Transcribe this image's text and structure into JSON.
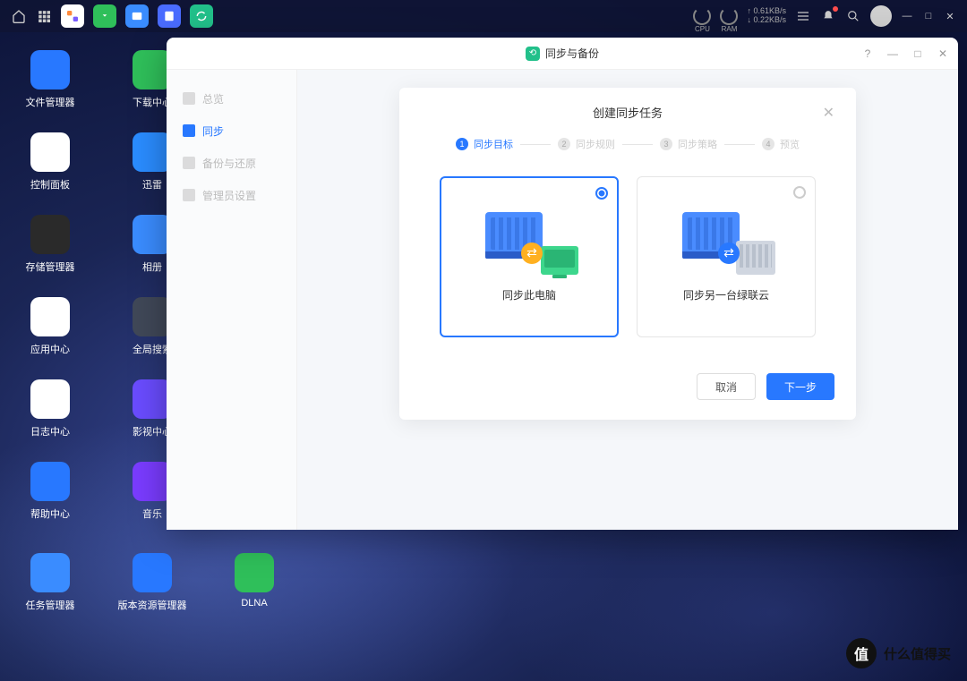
{
  "topbar": {
    "cpu_label": "CPU",
    "ram_label": "RAM",
    "net_up": "↑ 0.61KB/s",
    "net_down": "↓ 0.22KB/s"
  },
  "desktop_icons": {
    "col1": [
      {
        "label": "文件管理器",
        "bg": "#2878ff"
      },
      {
        "label": "控制面板",
        "bg": "#ffffff"
      },
      {
        "label": "存储管理器",
        "bg": "#2a2a2a"
      },
      {
        "label": "应用中心",
        "bg": "#ffffff"
      },
      {
        "label": "日志中心",
        "bg": "#ffffff"
      },
      {
        "label": "帮助中心",
        "bg": "#2878ff"
      },
      {
        "label": "任务管理器",
        "bg": "#3a8cff"
      }
    ],
    "col2": [
      {
        "label": "下载中心",
        "bg": "#2fbf5a"
      },
      {
        "label": "迅雷",
        "bg": "#2a8cff"
      },
      {
        "label": "相册",
        "bg": "#3a8cff"
      },
      {
        "label": "全局搜索",
        "bg": "#404858"
      },
      {
        "label": "影视中心",
        "bg": "#6a4cff"
      },
      {
        "label": "音乐",
        "bg": "#7a3cff"
      },
      {
        "label": "版本资源管理器",
        "bg": "#2878ff"
      }
    ],
    "col3": [
      {
        "label": "DLNA",
        "bg": "#2fbf5a"
      }
    ]
  },
  "app": {
    "title": "同步与备份",
    "sidebar": [
      {
        "label": "总览",
        "active": false
      },
      {
        "label": "同步",
        "active": true
      },
      {
        "label": "备份与还原",
        "active": false
      },
      {
        "label": "管理员设置",
        "active": false
      }
    ]
  },
  "modal": {
    "title": "创建同步任务",
    "steps": [
      {
        "num": "1",
        "label": "同步目标",
        "active": true
      },
      {
        "num": "2",
        "label": "同步规则",
        "active": false
      },
      {
        "num": "3",
        "label": "同步策略",
        "active": false
      },
      {
        "num": "4",
        "label": "预览",
        "active": false
      }
    ],
    "options": [
      {
        "label": "同步此电脑",
        "selected": true
      },
      {
        "label": "同步另一台绿联云",
        "selected": false
      }
    ],
    "cancel": "取消",
    "next": "下一步"
  },
  "watermark": {
    "circle": "值",
    "text": "什么值得买"
  }
}
